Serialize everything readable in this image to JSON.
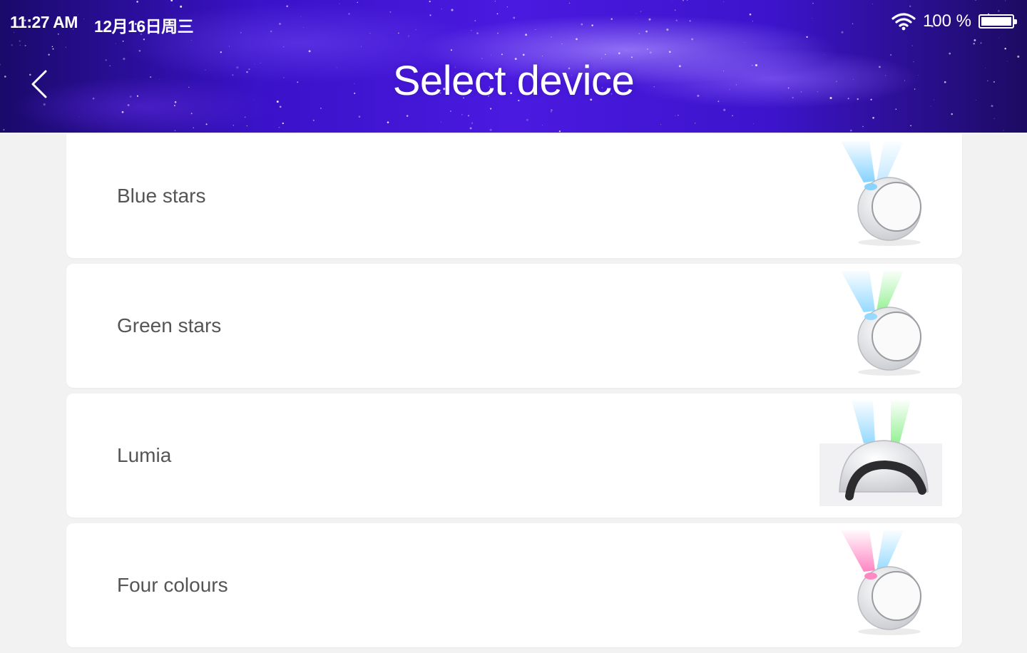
{
  "status_bar": {
    "time": "11:27 AM",
    "date": "12月16日周三",
    "battery": "100 %",
    "battery_level": 1.0,
    "wifi_icon": "wifi-icon",
    "battery_icon": "battery-icon"
  },
  "header": {
    "title": "Select device",
    "back_icon": "chevron-left-icon"
  },
  "colors": {
    "header_bg": "#3a12c8",
    "page_bg": "#f2f2f2",
    "card_bg": "#ffffff",
    "device_text": "#555555"
  },
  "devices": [
    {
      "name": "Blue stars",
      "image": "projector-blue-beam",
      "beams": [
        "#7fd0ff",
        "#bfe6ff"
      ]
    },
    {
      "name": "Green stars",
      "image": "projector-green-blue-beam",
      "beams": [
        "#8fd8ff",
        "#8ff08f"
      ]
    },
    {
      "name": "Lumia",
      "image": "dome-projector-blue-green-beam",
      "beams": [
        "#8fd8ff",
        "#8ff08f"
      ]
    },
    {
      "name": "Four colours",
      "image": "projector-pink-blue-beam",
      "beams": [
        "#ff7fbf",
        "#8fd8ff"
      ]
    }
  ]
}
